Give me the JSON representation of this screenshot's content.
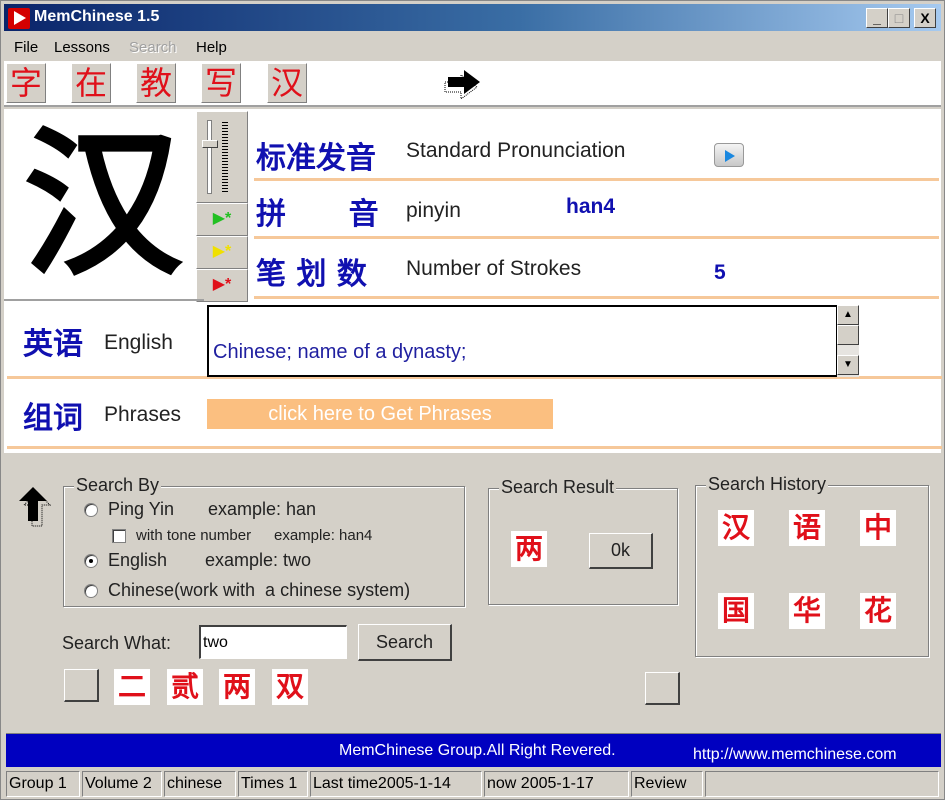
{
  "window": {
    "title": "MemChinese 1.5",
    "controls": {
      "minimize": "_",
      "maximize": "□",
      "close": "X"
    }
  },
  "menu": [
    {
      "label": "File",
      "enabled": true
    },
    {
      "label": "Lessons",
      "enabled": true
    },
    {
      "label": "Search",
      "enabled": false
    },
    {
      "label": "Help",
      "enabled": true
    }
  ],
  "toolbar": {
    "chars": [
      "字",
      "在",
      "教",
      "写",
      "汉"
    ],
    "next_icon": "arrow-right-icon"
  },
  "character": {
    "glyph": "汉",
    "volume_slider_level": 0.3,
    "play_buttons": [
      {
        "icon": "play-green-icon",
        "glyph": "▶*"
      },
      {
        "icon": "play-yellow-icon",
        "glyph": "▶*"
      },
      {
        "icon": "play-red-icon",
        "glyph": "▶*"
      }
    ]
  },
  "info": {
    "pronunciation": {
      "cn": "标准发音",
      "en": "Standard Pronunciation"
    },
    "pinyin": {
      "cn": "拼      音",
      "en": "pinyin",
      "value": "han4"
    },
    "strokes": {
      "cn": "笔 划 数",
      "en": "Number of Strokes",
      "value": "5"
    }
  },
  "english": {
    "cn": "英语",
    "en": "English",
    "meaning": "Chinese; name of a dynasty;"
  },
  "phrases": {
    "cn": "组词",
    "en": "Phrases",
    "button": "click here to Get Phrases"
  },
  "search_by": {
    "title": "Search By",
    "options": [
      {
        "label": "Ping Yin",
        "example": "example: han",
        "checked": false
      },
      {
        "label": "English",
        "example": "example: two",
        "checked": true
      },
      {
        "label": "Chinese(work with  a chinese system)",
        "example": "",
        "checked": false
      }
    ],
    "tone_checkbox": {
      "label": "with tone number",
      "example": "example: han4",
      "checked": false
    }
  },
  "search_result": {
    "title": "Search Result",
    "char": "两",
    "ok_button": "0k"
  },
  "search_history": {
    "title": "Search History",
    "chars": [
      "汉",
      "语",
      "中",
      "国",
      "华",
      "花"
    ]
  },
  "search_what": {
    "label": "Search What:",
    "value": "two",
    "button": "Search",
    "results": [
      "二",
      "贰",
      "两",
      "双"
    ]
  },
  "footer": {
    "copyright": "MemChinese Group.All Right Revered.",
    "url": "http://www.memchinese.com"
  },
  "status": [
    "Group 1",
    "Volume 2",
    "chinese",
    "Times 1",
    "Last time2005-1-14",
    "now 2005-1-17",
    "Review",
    ""
  ]
}
